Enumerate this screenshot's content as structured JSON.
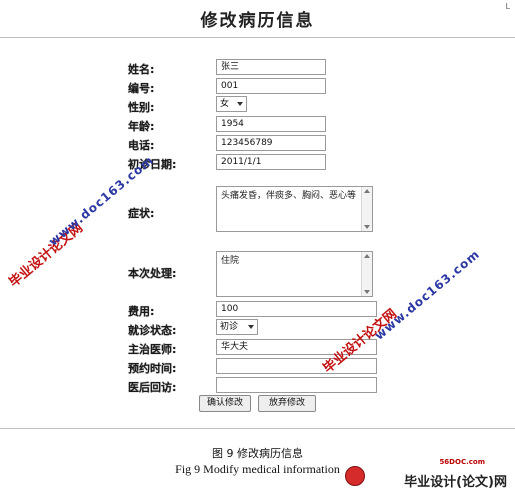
{
  "page": {
    "title": "修改病历信息",
    "corner_mark": "L"
  },
  "form": {
    "name": {
      "label": "姓名:",
      "value": "张三"
    },
    "number": {
      "label": "编号:",
      "value": "001"
    },
    "gender": {
      "label": "性别:",
      "value": "女"
    },
    "age": {
      "label": "年龄:",
      "value": "1954"
    },
    "phone": {
      "label": "电话:",
      "value": "123456789"
    },
    "first_visit_date": {
      "label": "初诊日期:",
      "value": "2011/1/1"
    },
    "symptoms": {
      "label": "症状:",
      "value": "头痛发昏，伴痰多、胸闷、恶心等"
    },
    "treatment": {
      "label": "本次处理:",
      "value": "住院"
    },
    "fee": {
      "label": "费用:",
      "value": "100"
    },
    "visit_status": {
      "label": "就诊状态:",
      "value": "初诊"
    },
    "attending_doctor": {
      "label": "主治医师:",
      "value": "华大夫"
    },
    "appointment_time": {
      "label": "预约时间:",
      "value": ""
    },
    "followup": {
      "label": "医后回访:",
      "value": ""
    }
  },
  "buttons": {
    "confirm": "确认修改",
    "discard": "放弃修改"
  },
  "caption": {
    "cn": "图 9    修改病历信息",
    "en": "Fig 9 Modify medical information"
  },
  "watermarks": {
    "cn": "毕业设计论文网",
    "url": "www.doc163.com"
  },
  "logo": {
    "site": "56DOC.com",
    "text": "毕业设计(论文)网"
  },
  "colors": {
    "watermark_red": "#c31010",
    "watermark_blue": "#2b38a3"
  }
}
